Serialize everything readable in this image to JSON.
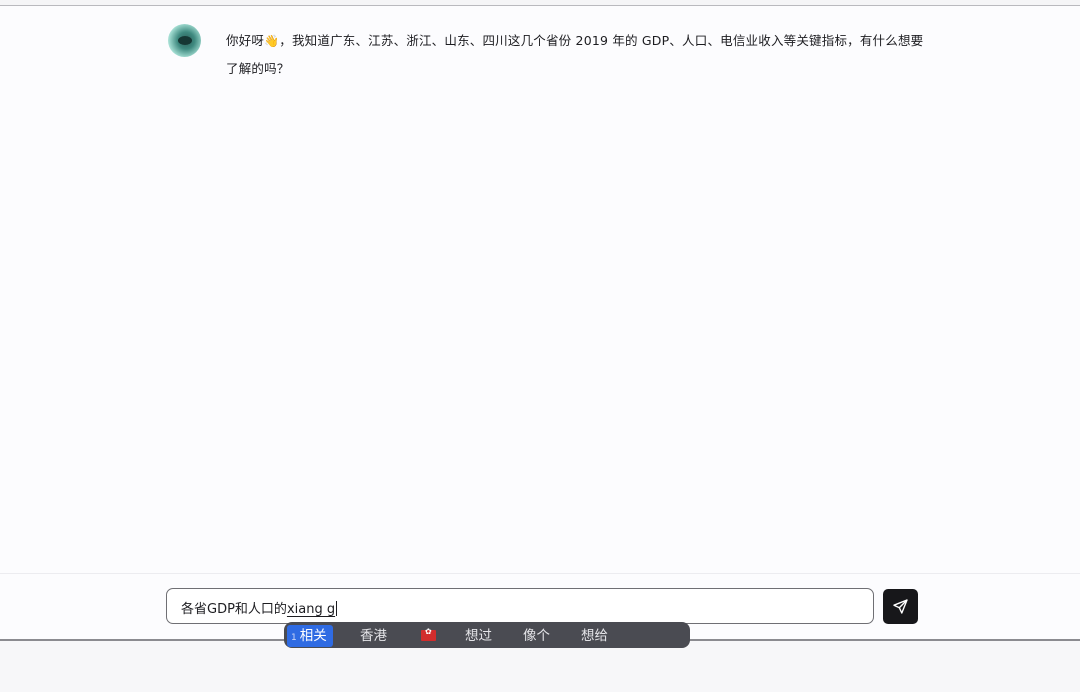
{
  "conversation": {
    "assistant_message": {
      "text_before_emoji": "你好呀",
      "emoji": "👋",
      "text_after_emoji": "，我知道广东、江苏、浙江、山东、四川这几个省份 2019 年的 GDP、人口、电信业收入等关键指标，有什么想要了解的吗？"
    }
  },
  "composer": {
    "committed_text": "各省GDP和人口的",
    "composing_text": "xiang g",
    "send_icon": "send-arrow-icon"
  },
  "ime": {
    "candidates": [
      {
        "index": "1",
        "text": "相关",
        "selected": true
      },
      {
        "text": "香港"
      },
      {
        "icon": "hong-kong-flag-icon"
      },
      {
        "text": "想过"
      },
      {
        "text": "像个"
      },
      {
        "text": "想给"
      }
    ]
  },
  "colors": {
    "send_button": "#17171a",
    "ime_selected": "#2f6be3",
    "ime_background": "#4a4b52"
  }
}
